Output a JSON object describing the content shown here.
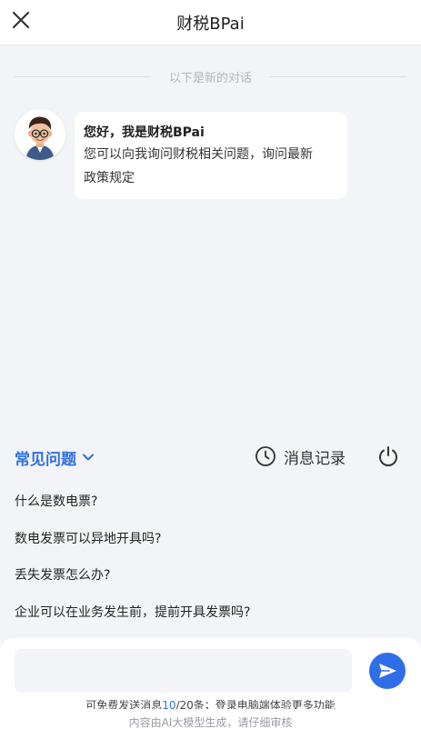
{
  "header": {
    "title": "财税BPai",
    "close_icon": "close-icon"
  },
  "chat": {
    "divider_text": "以下是新的对话",
    "bot_greeting_title": "您好，我是财税BPai",
    "bot_greeting_line1": "您可以向我询问财税相关问题，询问最新",
    "bot_greeting_line2": "政策规定"
  },
  "toolbar": {
    "faq_label": "常见问题",
    "history_label": "消息记录",
    "faq_icon": "chevron-down-icon",
    "history_icon": "clock-icon",
    "power_icon": "power-icon"
  },
  "faq": {
    "items": [
      "什么是数电票?",
      "数电发票可以异地开具吗?",
      "丢失发票怎么办?",
      "企业可以在业务发生前，提前开具发票吗?"
    ]
  },
  "composer": {
    "input_value": "",
    "quota_prefix": "可免费发送消息",
    "quota_used": "10",
    "quota_suffix": "/20条；登录电脑端体验更多功能",
    "disclaimer": "内容由AI大模型生成，请仔细审核",
    "send_icon": "send-icon"
  },
  "colors": {
    "accent": "#2f6ee6",
    "background": "#f3f4f7"
  }
}
